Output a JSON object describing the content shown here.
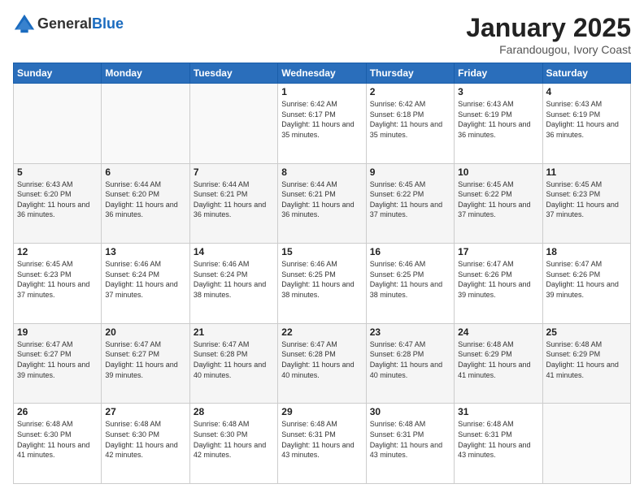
{
  "header": {
    "logo_line1": "General",
    "logo_line2": "Blue",
    "title": "January 2025",
    "location": "Farandougou, Ivory Coast"
  },
  "weekdays": [
    "Sunday",
    "Monday",
    "Tuesday",
    "Wednesday",
    "Thursday",
    "Friday",
    "Saturday"
  ],
  "weeks": [
    [
      {
        "day": "",
        "sunrise": "",
        "sunset": "",
        "daylight": ""
      },
      {
        "day": "",
        "sunrise": "",
        "sunset": "",
        "daylight": ""
      },
      {
        "day": "",
        "sunrise": "",
        "sunset": "",
        "daylight": ""
      },
      {
        "day": "1",
        "sunrise": "Sunrise: 6:42 AM",
        "sunset": "Sunset: 6:17 PM",
        "daylight": "Daylight: 11 hours and 35 minutes."
      },
      {
        "day": "2",
        "sunrise": "Sunrise: 6:42 AM",
        "sunset": "Sunset: 6:18 PM",
        "daylight": "Daylight: 11 hours and 35 minutes."
      },
      {
        "day": "3",
        "sunrise": "Sunrise: 6:43 AM",
        "sunset": "Sunset: 6:19 PM",
        "daylight": "Daylight: 11 hours and 36 minutes."
      },
      {
        "day": "4",
        "sunrise": "Sunrise: 6:43 AM",
        "sunset": "Sunset: 6:19 PM",
        "daylight": "Daylight: 11 hours and 36 minutes."
      }
    ],
    [
      {
        "day": "5",
        "sunrise": "Sunrise: 6:43 AM",
        "sunset": "Sunset: 6:20 PM",
        "daylight": "Daylight: 11 hours and 36 minutes."
      },
      {
        "day": "6",
        "sunrise": "Sunrise: 6:44 AM",
        "sunset": "Sunset: 6:20 PM",
        "daylight": "Daylight: 11 hours and 36 minutes."
      },
      {
        "day": "7",
        "sunrise": "Sunrise: 6:44 AM",
        "sunset": "Sunset: 6:21 PM",
        "daylight": "Daylight: 11 hours and 36 minutes."
      },
      {
        "day": "8",
        "sunrise": "Sunrise: 6:44 AM",
        "sunset": "Sunset: 6:21 PM",
        "daylight": "Daylight: 11 hours and 36 minutes."
      },
      {
        "day": "9",
        "sunrise": "Sunrise: 6:45 AM",
        "sunset": "Sunset: 6:22 PM",
        "daylight": "Daylight: 11 hours and 37 minutes."
      },
      {
        "day": "10",
        "sunrise": "Sunrise: 6:45 AM",
        "sunset": "Sunset: 6:22 PM",
        "daylight": "Daylight: 11 hours and 37 minutes."
      },
      {
        "day": "11",
        "sunrise": "Sunrise: 6:45 AM",
        "sunset": "Sunset: 6:23 PM",
        "daylight": "Daylight: 11 hours and 37 minutes."
      }
    ],
    [
      {
        "day": "12",
        "sunrise": "Sunrise: 6:45 AM",
        "sunset": "Sunset: 6:23 PM",
        "daylight": "Daylight: 11 hours and 37 minutes."
      },
      {
        "day": "13",
        "sunrise": "Sunrise: 6:46 AM",
        "sunset": "Sunset: 6:24 PM",
        "daylight": "Daylight: 11 hours and 37 minutes."
      },
      {
        "day": "14",
        "sunrise": "Sunrise: 6:46 AM",
        "sunset": "Sunset: 6:24 PM",
        "daylight": "Daylight: 11 hours and 38 minutes."
      },
      {
        "day": "15",
        "sunrise": "Sunrise: 6:46 AM",
        "sunset": "Sunset: 6:25 PM",
        "daylight": "Daylight: 11 hours and 38 minutes."
      },
      {
        "day": "16",
        "sunrise": "Sunrise: 6:46 AM",
        "sunset": "Sunset: 6:25 PM",
        "daylight": "Daylight: 11 hours and 38 minutes."
      },
      {
        "day": "17",
        "sunrise": "Sunrise: 6:47 AM",
        "sunset": "Sunset: 6:26 PM",
        "daylight": "Daylight: 11 hours and 39 minutes."
      },
      {
        "day": "18",
        "sunrise": "Sunrise: 6:47 AM",
        "sunset": "Sunset: 6:26 PM",
        "daylight": "Daylight: 11 hours and 39 minutes."
      }
    ],
    [
      {
        "day": "19",
        "sunrise": "Sunrise: 6:47 AM",
        "sunset": "Sunset: 6:27 PM",
        "daylight": "Daylight: 11 hours and 39 minutes."
      },
      {
        "day": "20",
        "sunrise": "Sunrise: 6:47 AM",
        "sunset": "Sunset: 6:27 PM",
        "daylight": "Daylight: 11 hours and 39 minutes."
      },
      {
        "day": "21",
        "sunrise": "Sunrise: 6:47 AM",
        "sunset": "Sunset: 6:28 PM",
        "daylight": "Daylight: 11 hours and 40 minutes."
      },
      {
        "day": "22",
        "sunrise": "Sunrise: 6:47 AM",
        "sunset": "Sunset: 6:28 PM",
        "daylight": "Daylight: 11 hours and 40 minutes."
      },
      {
        "day": "23",
        "sunrise": "Sunrise: 6:47 AM",
        "sunset": "Sunset: 6:28 PM",
        "daylight": "Daylight: 11 hours and 40 minutes."
      },
      {
        "day": "24",
        "sunrise": "Sunrise: 6:48 AM",
        "sunset": "Sunset: 6:29 PM",
        "daylight": "Daylight: 11 hours and 41 minutes."
      },
      {
        "day": "25",
        "sunrise": "Sunrise: 6:48 AM",
        "sunset": "Sunset: 6:29 PM",
        "daylight": "Daylight: 11 hours and 41 minutes."
      }
    ],
    [
      {
        "day": "26",
        "sunrise": "Sunrise: 6:48 AM",
        "sunset": "Sunset: 6:30 PM",
        "daylight": "Daylight: 11 hours and 41 minutes."
      },
      {
        "day": "27",
        "sunrise": "Sunrise: 6:48 AM",
        "sunset": "Sunset: 6:30 PM",
        "daylight": "Daylight: 11 hours and 42 minutes."
      },
      {
        "day": "28",
        "sunrise": "Sunrise: 6:48 AM",
        "sunset": "Sunset: 6:30 PM",
        "daylight": "Daylight: 11 hours and 42 minutes."
      },
      {
        "day": "29",
        "sunrise": "Sunrise: 6:48 AM",
        "sunset": "Sunset: 6:31 PM",
        "daylight": "Daylight: 11 hours and 43 minutes."
      },
      {
        "day": "30",
        "sunrise": "Sunrise: 6:48 AM",
        "sunset": "Sunset: 6:31 PM",
        "daylight": "Daylight: 11 hours and 43 minutes."
      },
      {
        "day": "31",
        "sunrise": "Sunrise: 6:48 AM",
        "sunset": "Sunset: 6:31 PM",
        "daylight": "Daylight: 11 hours and 43 minutes."
      },
      {
        "day": "",
        "sunrise": "",
        "sunset": "",
        "daylight": ""
      }
    ]
  ]
}
